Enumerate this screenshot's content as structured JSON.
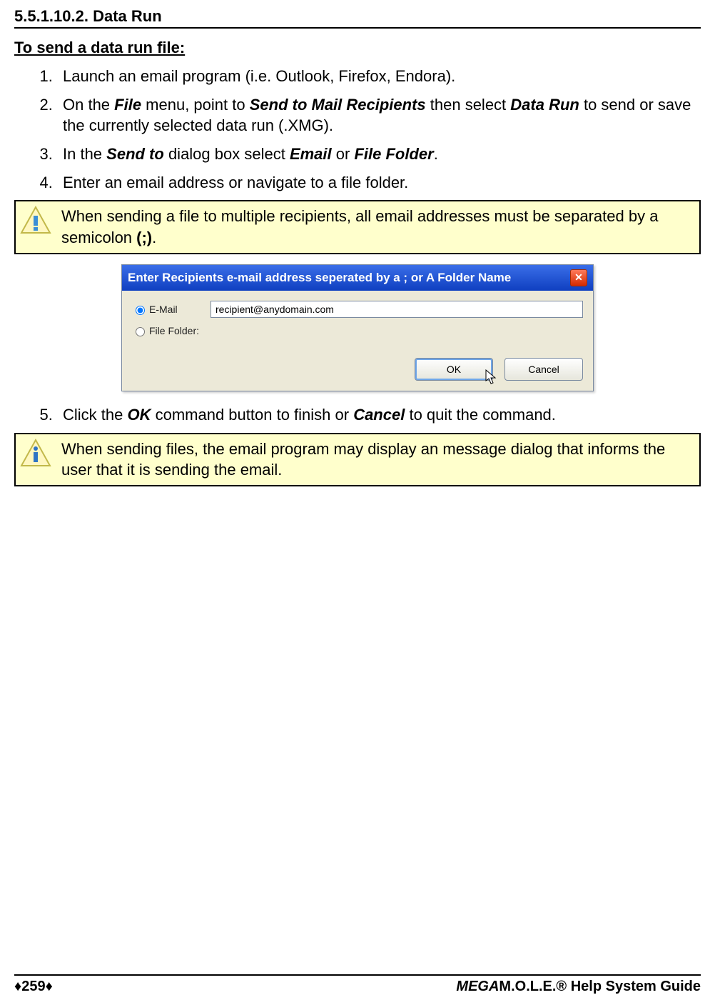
{
  "heading": "5.5.1.10.2. Data Run",
  "subheading": "To send a data run file:",
  "steps": {
    "1": {
      "text": "Launch an email program (i.e. Outlook, Firefox, Endora)."
    },
    "2": {
      "pre": "On the ",
      "b1": "File",
      "mid1": " menu, point to ",
      "b2": "Send to Mail Recipients",
      "mid2": " then select ",
      "b3": "Data Run",
      "post": " to send or save the currently selected data run (.XMG)."
    },
    "3": {
      "pre": "In the ",
      "b1": "Send to",
      "mid1": " dialog box select ",
      "b2": "Email",
      "mid2": " or ",
      "b3": "File Folder",
      "post": "."
    },
    "4": {
      "text": "Enter an email address or navigate to a file folder."
    },
    "5": {
      "pre": "Click the ",
      "b1": "OK",
      "mid1": " command button to finish or ",
      "b2": "Cancel",
      "post": " to quit the command."
    }
  },
  "notes": {
    "1": {
      "pre": "When sending a file to multiple recipients, all email addresses must be separated by a semicolon ",
      "b": "(;)",
      "post": "."
    },
    "2": {
      "text": "When sending files, the email program may display an message dialog that informs the user that it is sending the email."
    }
  },
  "dialog": {
    "title": "Enter Recipients e-mail address seperated by a ; or A Folder Name",
    "emailLabel": "E-Mail",
    "folderLabel": "File Folder:",
    "emailValue": "recipient@anydomain.com",
    "ok": "OK",
    "cancel": "Cancel"
  },
  "footer": {
    "pageMarker": "♦259♦",
    "guidePrefix": "MEGA",
    "guideRest": "M.O.L.E.® Help System Guide"
  }
}
